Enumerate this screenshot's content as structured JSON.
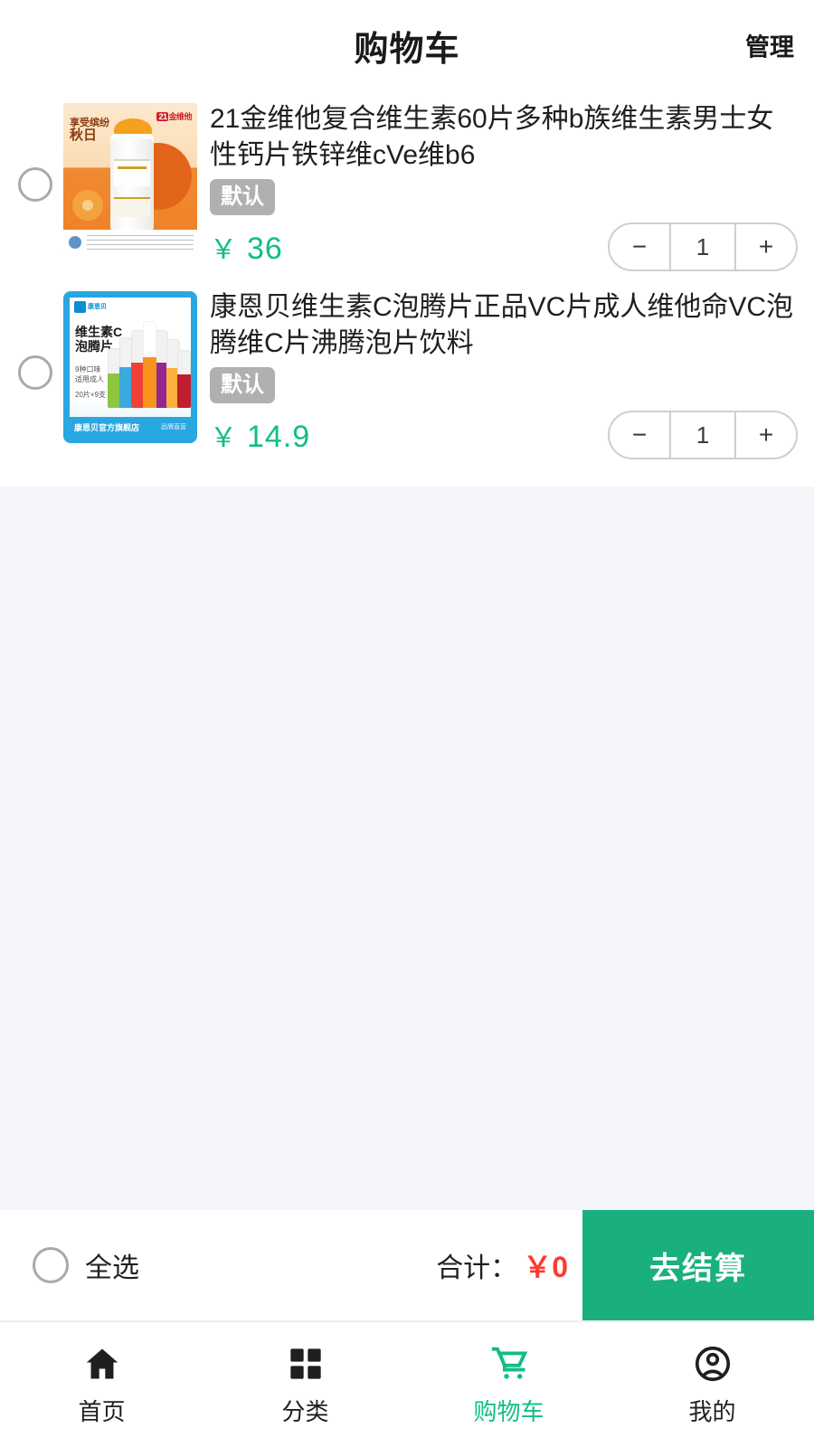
{
  "header": {
    "title": "购物车",
    "action_label": "管理"
  },
  "cart": {
    "items": [
      {
        "checked": false,
        "title": "21金维他复合维生素60片多种b族维生素男士女性钙片铁锌维cVe维b6",
        "spec": "默认",
        "currency": "￥",
        "price": "36",
        "quantity": "1",
        "minus_label": "−",
        "plus_label": "+",
        "thumb": {
          "kind": "autumn-supplement-bottle",
          "brand": "21金维他",
          "vertical_text_1": "享受缤纷",
          "vertical_text_2": "秋日",
          "vertical_text_3": "温润刚刚好"
        }
      },
      {
        "checked": false,
        "title": "康恩贝维生素C泡腾片正品VC片成人维他命VC泡腾维C片沸腾泡片饮料",
        "spec": "默认",
        "currency": "￥",
        "price": "14.9",
        "quantity": "1",
        "minus_label": "−",
        "plus_label": "+",
        "thumb": {
          "kind": "vc-effervescent-tubes",
          "brand": "康恩贝",
          "title_line1": "维生素C",
          "title_line2": "泡腾片",
          "sub1": "9种口味",
          "sub2": "适用成人",
          "sub3": "20片×9支",
          "footer_left": "康恩贝官方旗舰店",
          "footer_right": "品牌直营"
        }
      }
    ]
  },
  "checkout": {
    "select_all_label": "全选",
    "select_all_checked": false,
    "total_label": "合计：",
    "total_value": "￥0",
    "button_label": "去结算"
  },
  "tabbar": {
    "tabs": [
      {
        "label": "首页",
        "icon": "home-icon",
        "active": false
      },
      {
        "label": "分类",
        "icon": "grid-icon",
        "active": false
      },
      {
        "label": "购物车",
        "icon": "cart-icon",
        "active": true
      },
      {
        "label": "我的",
        "icon": "person-icon",
        "active": false
      }
    ]
  },
  "colors": {
    "accent_green": "#10bd88",
    "checkout_green": "#1ab07d",
    "total_red": "#ff3b30",
    "badge_gray": "#b0b0b0",
    "page_bg": "#f4f5f8"
  }
}
